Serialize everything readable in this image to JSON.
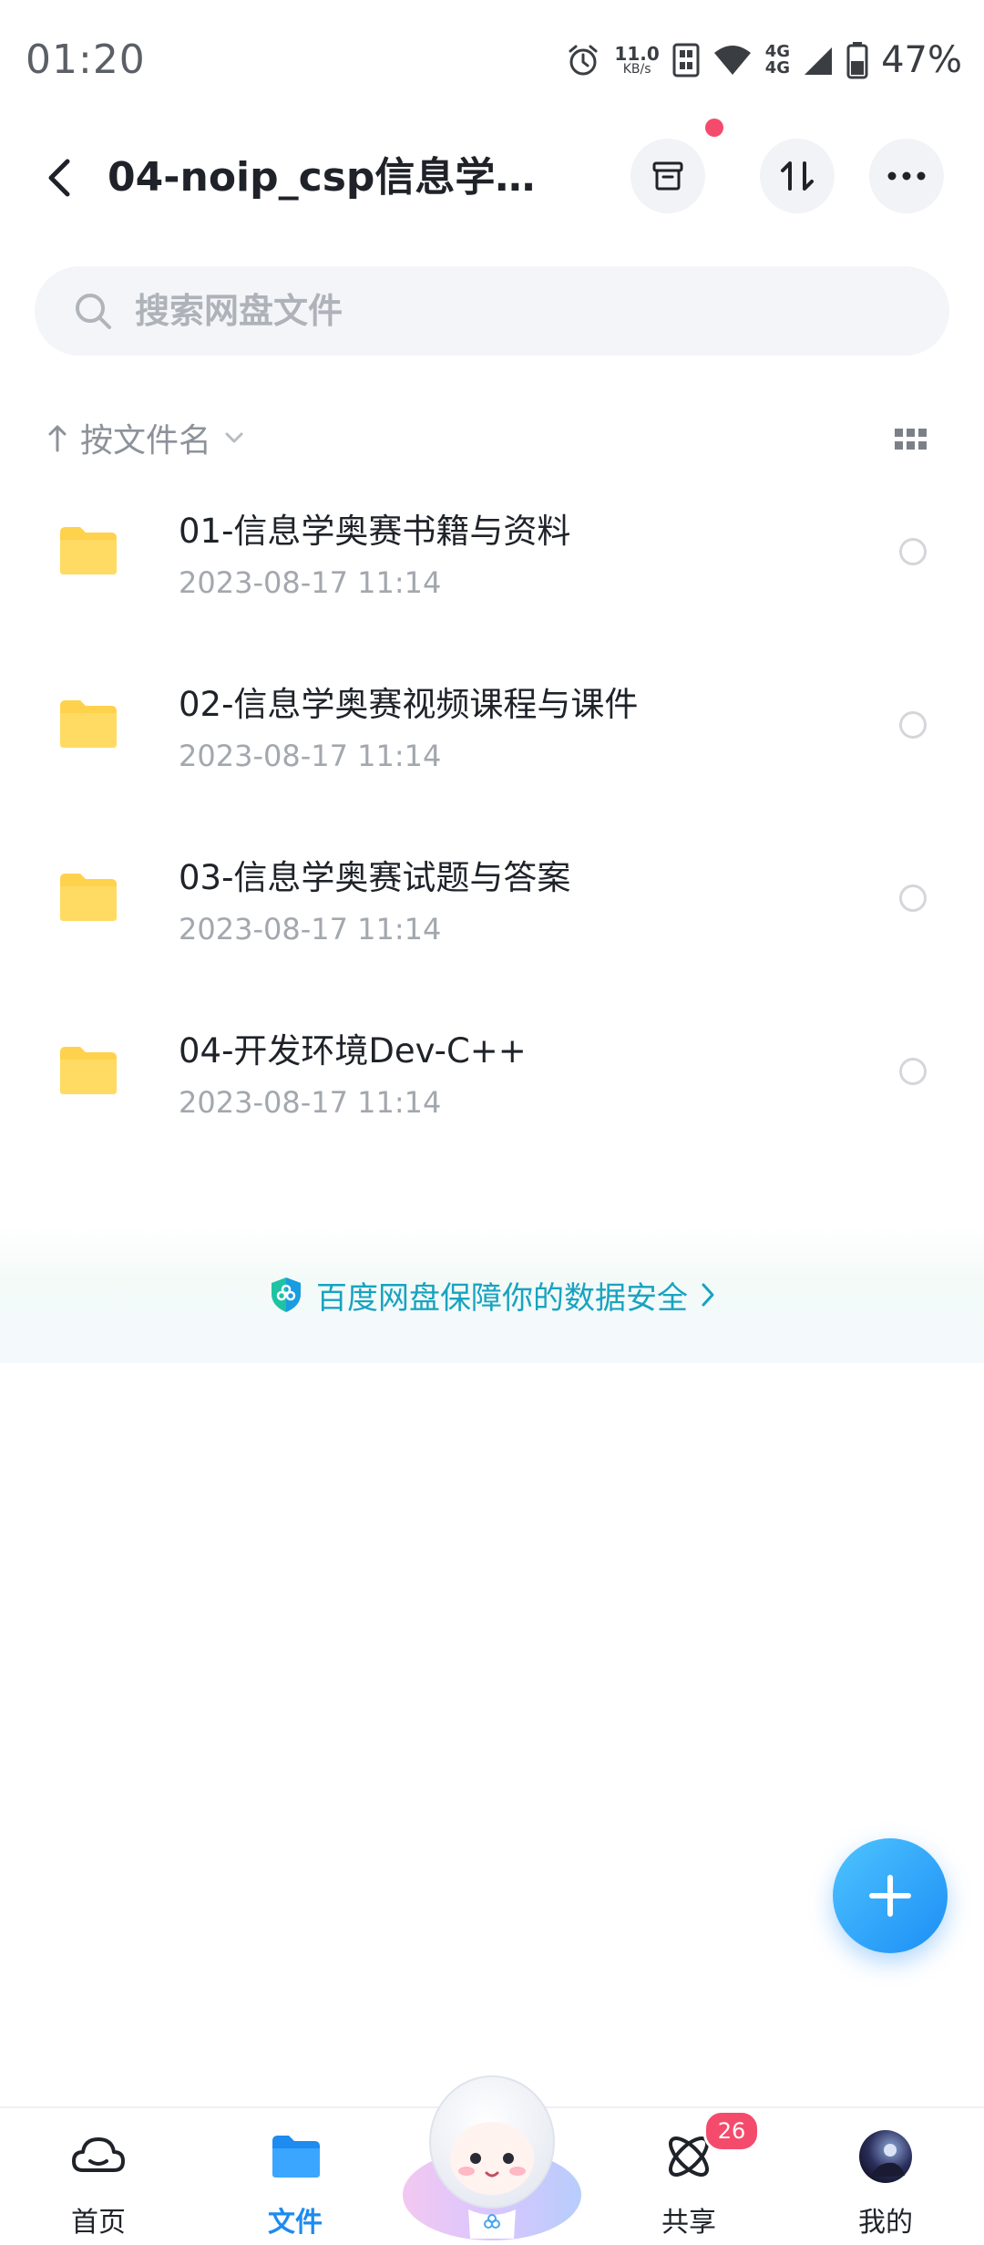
{
  "status_bar": {
    "time": "01:20",
    "net_speed_value": "11.0",
    "net_speed_unit": "KB/s",
    "network_1": "4G",
    "network_2": "4G",
    "battery": "47%",
    "icons": [
      "alarm-icon",
      "nfc-icon",
      "wifi-icon",
      "signal-icon",
      "battery-icon"
    ]
  },
  "header": {
    "title": "04-noip_csp信息学奥...",
    "buttons": [
      "archive-icon",
      "transfer-icon",
      "more-icon"
    ],
    "notification_dot_color": "#f44b6c"
  },
  "search": {
    "placeholder": "搜索网盘文件"
  },
  "sort": {
    "label": "按文件名"
  },
  "files": [
    {
      "name": "01-信息学奥赛书籍与资料",
      "date": "2023-08-17  11:14"
    },
    {
      "name": "02-信息学奥赛视频课程与课件",
      "date": "2023-08-17  11:14"
    },
    {
      "name": "03-信息学奥赛试题与答案",
      "date": "2023-08-17  11:14"
    },
    {
      "name": "04-开发环境Dev-C++",
      "date": "2023-08-17  11:14"
    }
  ],
  "safety_banner": {
    "text": "百度网盘保障你的数据安全"
  },
  "bottom_nav": {
    "items": [
      {
        "label": "首页",
        "icon": "home-cloud-icon"
      },
      {
        "label": "文件",
        "icon": "folder-icon",
        "active": true
      },
      {
        "label": "共享",
        "icon": "share-atom-icon",
        "badge": "26"
      },
      {
        "label": "我的",
        "icon": "avatar-icon"
      }
    ]
  },
  "colors": {
    "accent": "#1d8bf0",
    "folder": "#ffd24d",
    "badge": "#f44b6c",
    "safety_text": "#18a3c0"
  }
}
